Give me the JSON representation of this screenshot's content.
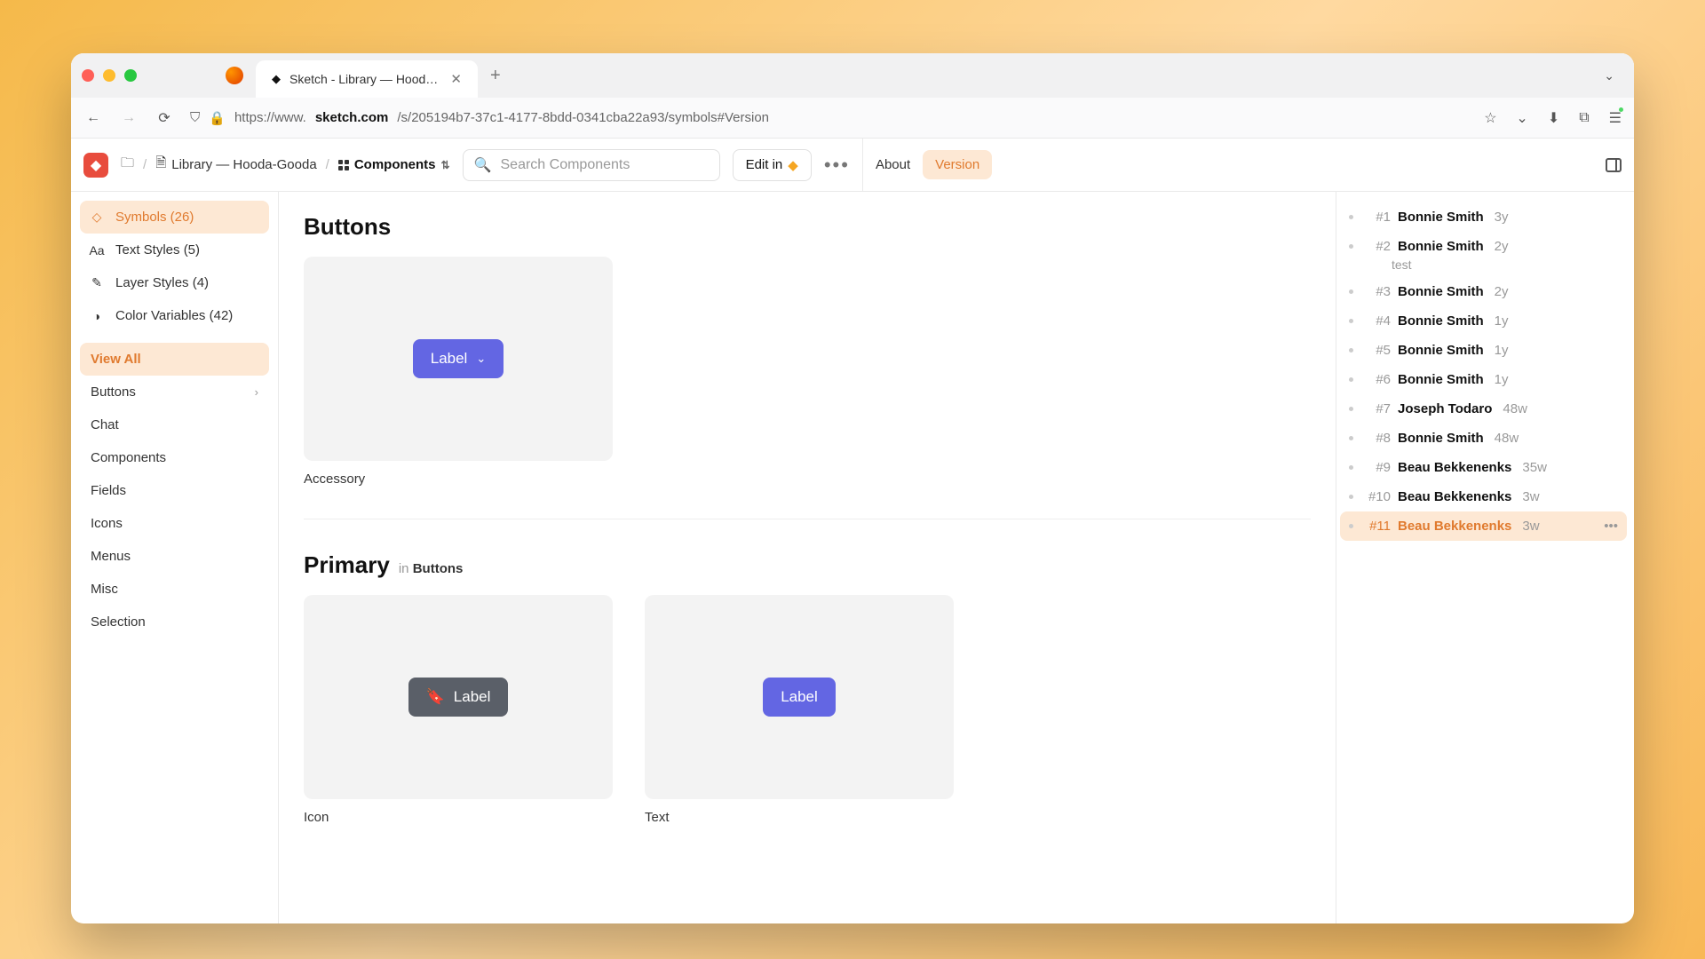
{
  "browser": {
    "tab_title": "Sketch - Library — Hooda-Good",
    "url_prefix": "https://www.",
    "url_host": "sketch.com",
    "url_path": "/s/205194b7-37c1-4177-8bdd-0341cba22a93/symbols#Version"
  },
  "header": {
    "breadcrumb_library": "Library — Hooda-Gooda",
    "breadcrumb_components": "Components",
    "search_placeholder": "Search Components",
    "edit_in": "Edit in",
    "about": "About",
    "version": "Version"
  },
  "sidebar": {
    "symbols": "Symbols (26)",
    "text_styles": "Text Styles (5)",
    "layer_styles": "Layer Styles (4)",
    "color_vars": "Color Variables (42)",
    "view_all": "View All",
    "categories": [
      "Buttons",
      "Chat",
      "Components",
      "Fields",
      "Icons",
      "Menus",
      "Misc",
      "Selection"
    ]
  },
  "main": {
    "section_buttons": "Buttons",
    "btn_label": "Label",
    "card_accessory": "Accessory",
    "section_primary": "Primary",
    "in_prefix": "in",
    "in_buttons": "Buttons",
    "card_icon": "Icon",
    "card_text": "Text"
  },
  "versions": [
    {
      "num": "#1",
      "name": "Bonnie Smith",
      "time": "3y",
      "note": ""
    },
    {
      "num": "#2",
      "name": "Bonnie Smith",
      "time": "2y",
      "note": "test"
    },
    {
      "num": "#3",
      "name": "Bonnie Smith",
      "time": "2y",
      "note": ""
    },
    {
      "num": "#4",
      "name": "Bonnie Smith",
      "time": "1y",
      "note": ""
    },
    {
      "num": "#5",
      "name": "Bonnie Smith",
      "time": "1y",
      "note": ""
    },
    {
      "num": "#6",
      "name": "Bonnie Smith",
      "time": "1y",
      "note": ""
    },
    {
      "num": "#7",
      "name": "Joseph Todaro",
      "time": "48w",
      "note": ""
    },
    {
      "num": "#8",
      "name": "Bonnie Smith",
      "time": "48w",
      "note": ""
    },
    {
      "num": "#9",
      "name": "Beau Bekkenenks",
      "time": "35w",
      "note": ""
    },
    {
      "num": "#10",
      "name": "Beau Bekkenenks",
      "time": "3w",
      "note": ""
    },
    {
      "num": "#11",
      "name": "Beau Bekkenenks",
      "time": "3w",
      "note": "",
      "active": true
    }
  ]
}
